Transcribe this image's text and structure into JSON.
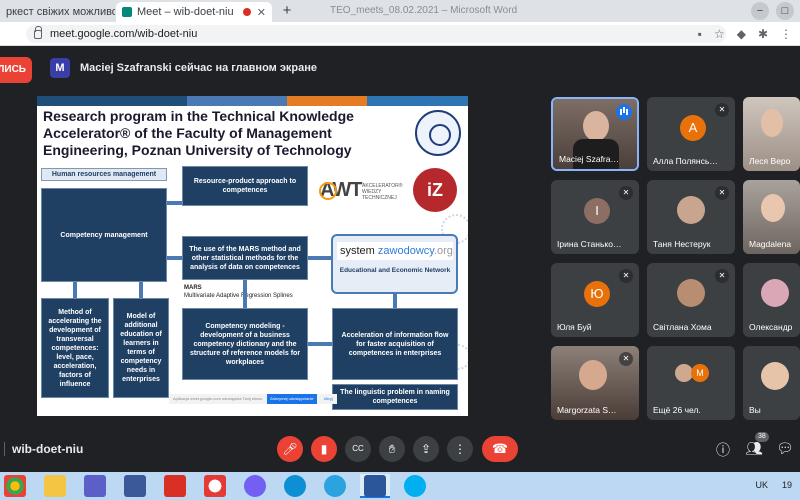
{
  "browser": {
    "tabs": [
      {
        "label": "ркест свіжих можливостей"
      },
      {
        "label": "Meet – wib-doet-niu"
      }
    ],
    "window_title": "TEO_meets_08.02.2021 – Microsoft Word",
    "url": "meet.google.com/wib-doet-niu",
    "new_tab_icon": "+",
    "minimize_icon": "−",
    "maximize_icon": "□"
  },
  "banner": {
    "stop_button_label": "ЛИСЬ",
    "presenter_initial": "M",
    "presenter_text": "Maciej Szafranski сейчас на главном экране",
    "stop_color": "#ea4335"
  },
  "slide": {
    "title": "Research program in the Technical Knowledge Accelerator® of the Faculty of Management Engineering, Poznan University of Technology",
    "boxes": {
      "hr": "Human resources management",
      "competency_mgmt": "Competency management",
      "resource_product": "Resource-product approach to competences",
      "mars_method": "The use of the MARS method and other statistical methods for the analysis of data on competences",
      "method_accel": "Method of accelerating the development of transversal competences: level, pace, acceleration, factors of influence",
      "model_edu": "Model of additional education of learners in terms of competency needs in enterprises",
      "competency_modeling": "Competency modeling - development of a business competency dictionary and the structure of reference models for workplaces",
      "acceleration_flow": "Acceleration of information flow for faster acquisition of competences in enterprises",
      "linguistic": "The linguistic problem in naming competences"
    },
    "mars_label": "MARS",
    "mars_full": "Multivariate Adaptive Regression Splines",
    "system_logo_a": "system ",
    "system_logo_b": "zawodowcy",
    "system_logo_c": ".org",
    "system_text": "Educational and Economic Network",
    "awt_mark": "AWT",
    "awt_text": "AKCELERATOR® WIEDZY TECHNICZNEJ",
    "iz_logo": "iZ",
    "share_strip_text": "Aplikacja meet.google.com udostępnia Twój ekran.",
    "share_strip_button": "Zatrzymaj udostępnianie",
    "share_strip_hide": "Ukryj",
    "colors": {
      "dark_box": "#1f3f63",
      "arrow": "#4a79b4",
      "logo_red": "#b5282b"
    }
  },
  "participants": [
    {
      "name": "Maciej Szafra…",
      "type": "video",
      "speaking": true
    },
    {
      "name": "Алла Полянсь…",
      "initial": "A",
      "color": "#e8710a",
      "muted": true
    },
    {
      "name": "Леся Веро",
      "type": "video"
    },
    {
      "name": "Ірина Станько…",
      "initial": "І",
      "color": "#8d6e63",
      "muted": true
    },
    {
      "name": "Таня Нестерук",
      "type": "photo",
      "muted": true
    },
    {
      "name": "Magdalena",
      "type": "video"
    },
    {
      "name": "Юля Буй",
      "initial": "Ю",
      "color": "#e8710a",
      "muted": true
    },
    {
      "name": "Світлана Хома",
      "type": "photo",
      "muted": true
    },
    {
      "name": "Олександр",
      "type": "photo"
    },
    {
      "name": "Margorzata S…",
      "type": "video",
      "muted": true
    },
    {
      "name": "Ещё 26 чел.",
      "initial": "M",
      "color": "#e8710a"
    },
    {
      "name": "Вы",
      "type": "photo"
    }
  ],
  "meetbar": {
    "meeting_code": "wib-doet-niu",
    "participants_count": "38",
    "captions_icon": "CC"
  },
  "taskbar": {
    "lang": "UK",
    "time": "19"
  }
}
